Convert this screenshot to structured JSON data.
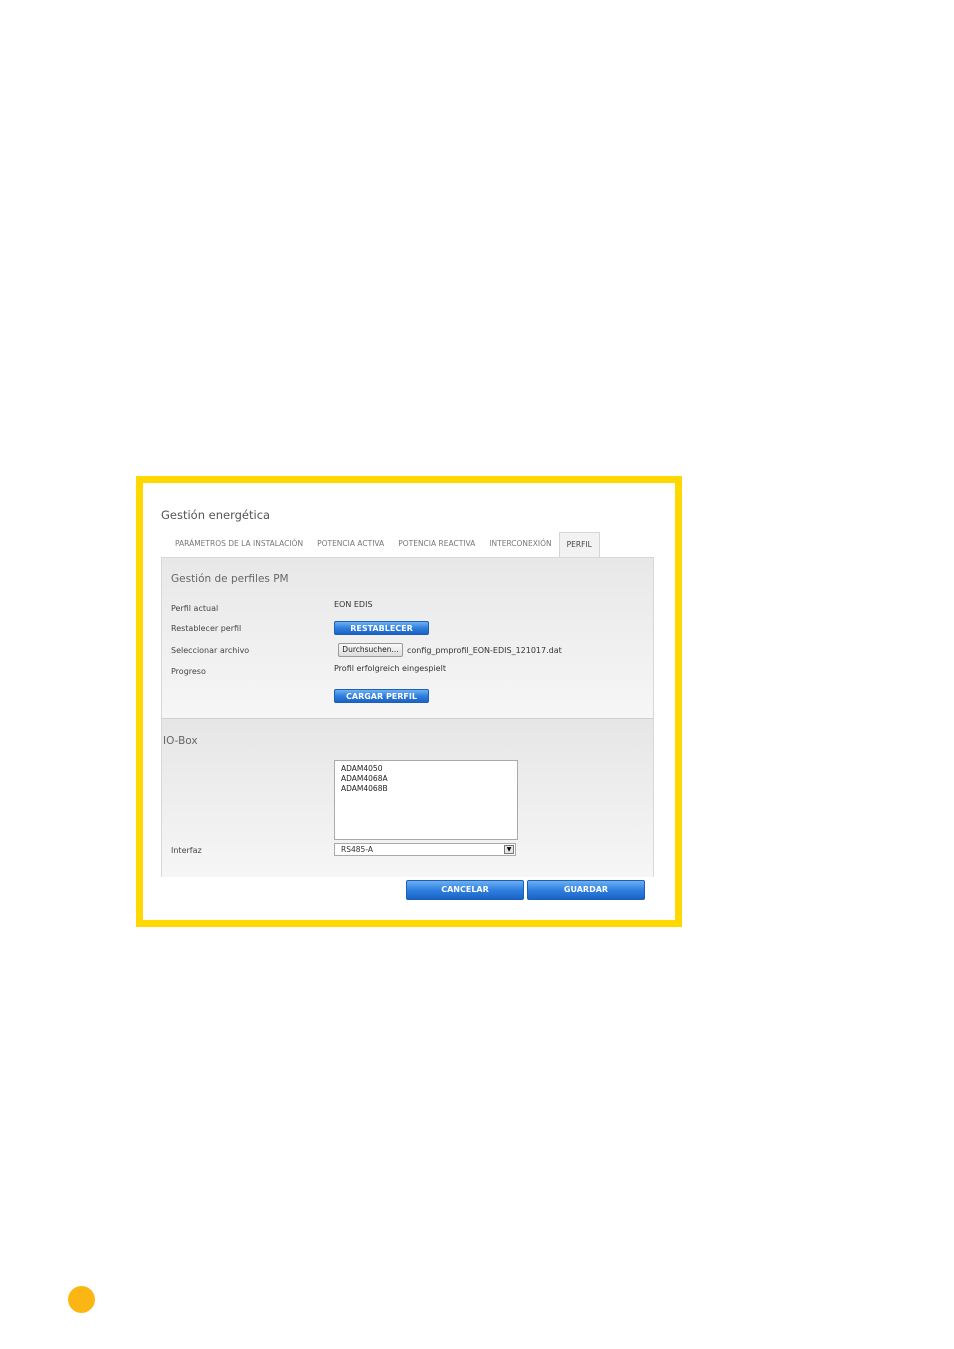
{
  "window": {
    "title": "Gestión energética"
  },
  "tabs": [
    {
      "label": "PARÁMETROS DE LA INSTALACIÓN",
      "active": false
    },
    {
      "label": "POTENCIA ACTIVA",
      "active": false
    },
    {
      "label": "POTENCIA REACTIVA",
      "active": false
    },
    {
      "label": "INTERCONEXIÓN",
      "active": false
    },
    {
      "label": "PERFIL",
      "active": true
    }
  ],
  "profiles": {
    "title": "Gestión de perfiles PM",
    "current_label": "Perfil actual",
    "current_value": "EON EDIS",
    "reset_label": "Restablecer perfil",
    "reset_button": "RESTABLECER",
    "file_label": "Seleccionar archivo",
    "browse_button": "Durchsuchen...",
    "file_name": "config_pmprofil_EON-EDIS_121017.dat",
    "progress_label": "Progreso",
    "progress_value": "Profil erfolgreich eingespielt",
    "upload_button": "CARGAR PERFIL"
  },
  "iobox": {
    "title": "IO-Box",
    "options": [
      "ADAM4050",
      "ADAM4068A",
      "ADAM4068B"
    ],
    "interface_label": "Interfaz",
    "interface_value": "RS485-A"
  },
  "footer": {
    "cancel": "CANCELAR",
    "save": "GUARDAR"
  },
  "colors": {
    "frame": "#ffd800",
    "button": "#2f7fde",
    "page_dot": "#fbb613"
  }
}
